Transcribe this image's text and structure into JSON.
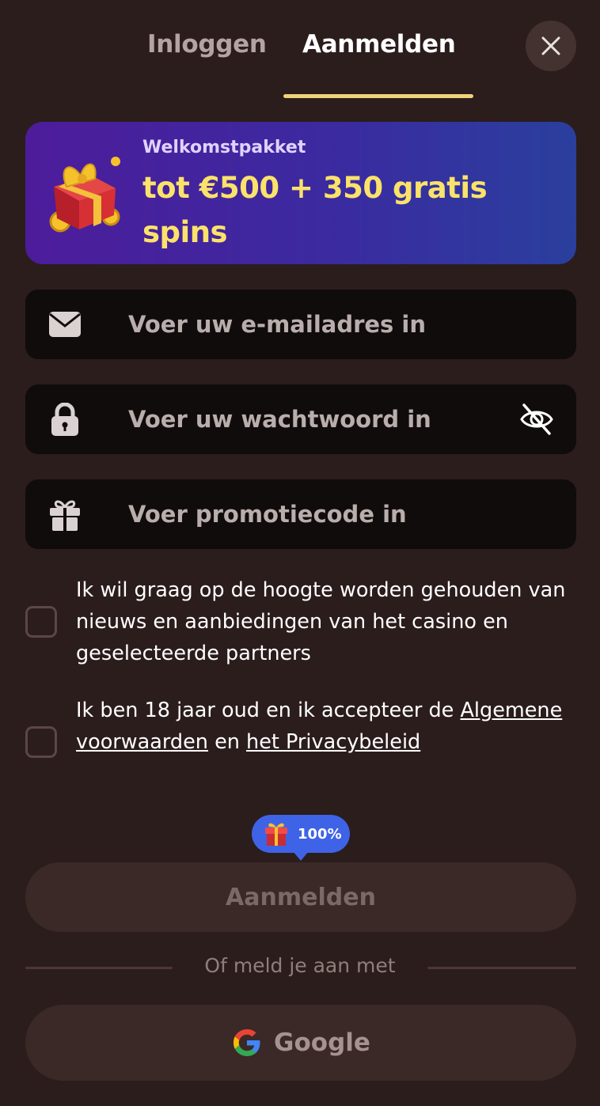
{
  "tabs": {
    "login_label": "Inloggen",
    "signup_label": "Aanmelden"
  },
  "banner": {
    "subtitle": "Welkomstpakket",
    "title": "tot €500 + 350 gratis spins"
  },
  "form": {
    "email_placeholder": "Voer uw e-mailadres in",
    "password_placeholder": "Voer uw wachtwoord in",
    "promo_placeholder": "Voer promotiecode in"
  },
  "consent": {
    "newsletter_text": "Ik wil graag op de hoogte worden gehouden van nieuws en aanbiedingen van het casino en geselecteerde partners",
    "age_text_prefix": "Ik ben 18 jaar oud en ik accepteer de ",
    "terms_link": "Algemene voorwaarden",
    "age_text_middle": " en ",
    "privacy_link": "het Privacybeleid"
  },
  "bonus_badge": {
    "value": "100%",
    "icon": "gift-icon"
  },
  "actions": {
    "signup_button": "Aanmelden",
    "divider_text": "Of meld je aan met",
    "google_button": "Google"
  },
  "colors": {
    "background": "#2b1d1c",
    "accent_gold": "#f0d27c",
    "banner_gradient_start": "#4d1c9b",
    "banner_gradient_end": "#2a3f9e",
    "banner_title": "#fbe26a",
    "badge_blue": "#3f63e6"
  }
}
